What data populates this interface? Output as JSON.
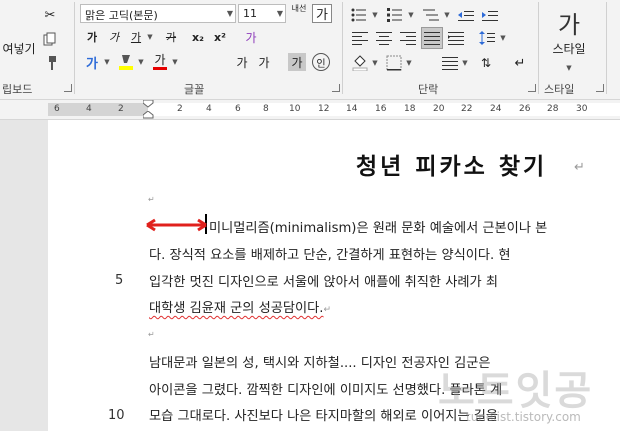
{
  "ribbon": {
    "clipboard": {
      "paste_label": "여넣기",
      "group_label": "립보드"
    },
    "font": {
      "font_name": "맑은 고딕(본문)",
      "font_size": "11",
      "grow_label": "내선",
      "clear_format_glyph": "가",
      "bold": "가",
      "italic": "가",
      "underline": "가",
      "strikethrough": "가",
      "subscript": "x₂",
      "superscript": "x²",
      "text_effect": "가",
      "font_color": "가",
      "case_label": "가",
      "phonetic_label": "가",
      "char_shade": "가",
      "enclose": "인",
      "group_label": "글꼴",
      "highlight_color": "#ffff00",
      "font_color_hex": "#e60000"
    },
    "paragraph": {
      "group_label": "단락"
    },
    "styles": {
      "button_label": "스타일",
      "button_glyph": "가",
      "group_label": "스타일"
    }
  },
  "ruler": {
    "ticks": [
      "6",
      "4",
      "2",
      "2",
      "4",
      "6",
      "8",
      "10",
      "12",
      "14",
      "16",
      "18",
      "20",
      "22",
      "24",
      "26",
      "28",
      "30"
    ]
  },
  "document": {
    "title": "청년 피카소 찾기",
    "paragraph_mark": "↵",
    "lines": [
      "미니멀리즘(minimalism)은 원래 문화 예술에서 근본이나 본",
      "다. 장식적 요소를 배제하고 단순, 간결하게 표현하는 양식이다. 현",
      "입각한 멋진 디자인으로 서울에 앉아서 애플에 취직한 사례가 최",
      "대학생 김윤재 군의 성공담이다.",
      "남대문과 일본의 성, 택시와 지하철.... 디자인 전공자인 김군은",
      "아이콘을 그렸다. 깜찍한 디자인에 이미지도 선명했다. 플라톤 계",
      "모습 그대로다. 사진보다 나은 타지마할의 해외로 이어지는 길을"
    ],
    "line_numbers": [
      "5",
      "10"
    ]
  },
  "annotation": {
    "color": "#e0201c"
  },
  "watermark": {
    "text": "노트잇공",
    "url": "tunelist.tistory.com"
  }
}
